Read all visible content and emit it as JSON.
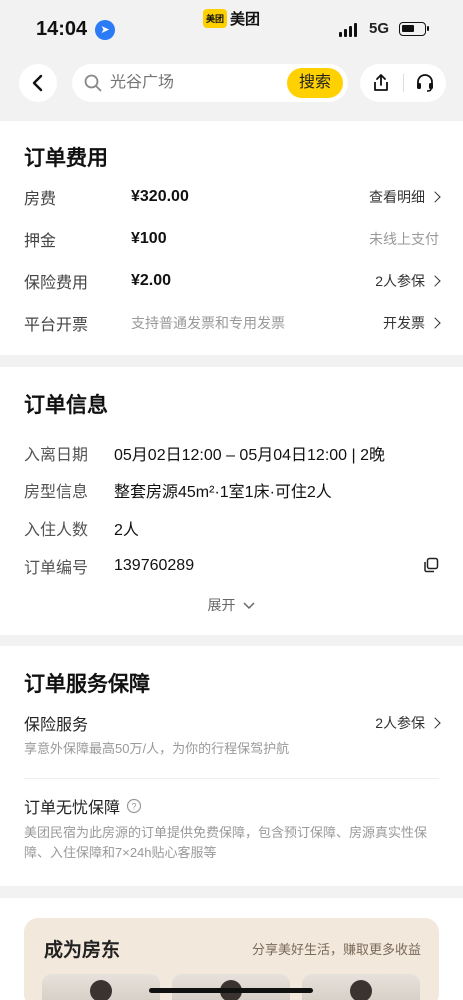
{
  "status": {
    "time": "14:04",
    "network": "5G",
    "app_badge": "美团",
    "app_name": "美团"
  },
  "search": {
    "placeholder": "光谷广场",
    "button": "搜索"
  },
  "fees": {
    "title": "订单费用",
    "rows": [
      {
        "label": "房费",
        "value": "¥320.00",
        "action": "查看明细"
      },
      {
        "label": "押金",
        "value": "¥100",
        "action": "未线上支付"
      },
      {
        "label": "保险费用",
        "value": "¥2.00",
        "action": "2人参保"
      },
      {
        "label": "平台开票",
        "value": "支持普通发票和专用发票",
        "action": "开发票"
      }
    ]
  },
  "order": {
    "title": "订单信息",
    "rows": [
      {
        "label": "入离日期",
        "value": "05月02日12:00 – 05月04日12:00 | 2晚"
      },
      {
        "label": "房型信息",
        "value": "整套房源45m²·1室1床·可住2人"
      },
      {
        "label": "入住人数",
        "value": "2人"
      },
      {
        "label": "订单编号",
        "value": "139760289"
      }
    ],
    "expand": "展开"
  },
  "service": {
    "title": "订单服务保障",
    "insurance_title": "保险服务",
    "insurance_action": "2人参保",
    "insurance_desc": "享意外保障最高50万/人，为你的行程保驾护航",
    "worry_title": "订单无忧保障",
    "worry_desc": "美团民宿为此房源的订单提供免费保障，包含预订保障、房源真实性保障、入住保障和7×24h贴心客服等"
  },
  "host": {
    "title": "成为房东",
    "subtitle": "分享美好生活，赚取更多收益"
  }
}
